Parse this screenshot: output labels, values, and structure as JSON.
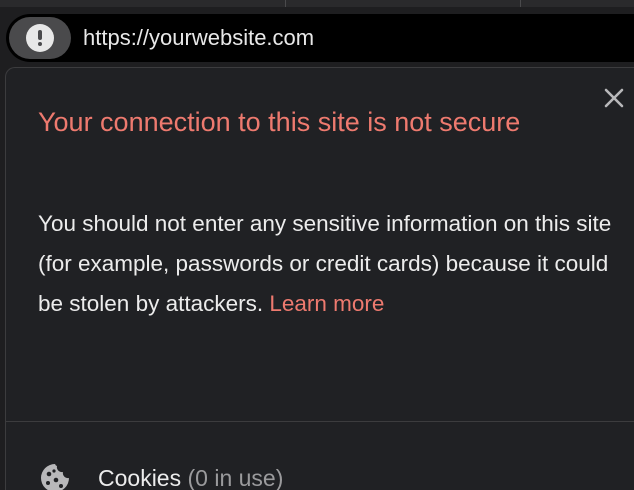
{
  "omnibox": {
    "url": "https://yourwebsite.com",
    "site_info_icon": "warning-icon"
  },
  "popup": {
    "title": "Your connection to this site is not secure",
    "body": "You should not enter any sensitive information on this site (for example, passwords or credit cards) because it could be stolen by attackers. ",
    "learn_more": "Learn more",
    "close_icon": "close-icon",
    "cookies": {
      "label": "Cookies",
      "count": "(0 in use)",
      "icon": "cookie-icon"
    }
  },
  "colors": {
    "warning_title": "#ee7a6f",
    "link": "#ee7a6f",
    "background": "#202124",
    "text": "#ececec",
    "muted": "#9a9a9c"
  }
}
